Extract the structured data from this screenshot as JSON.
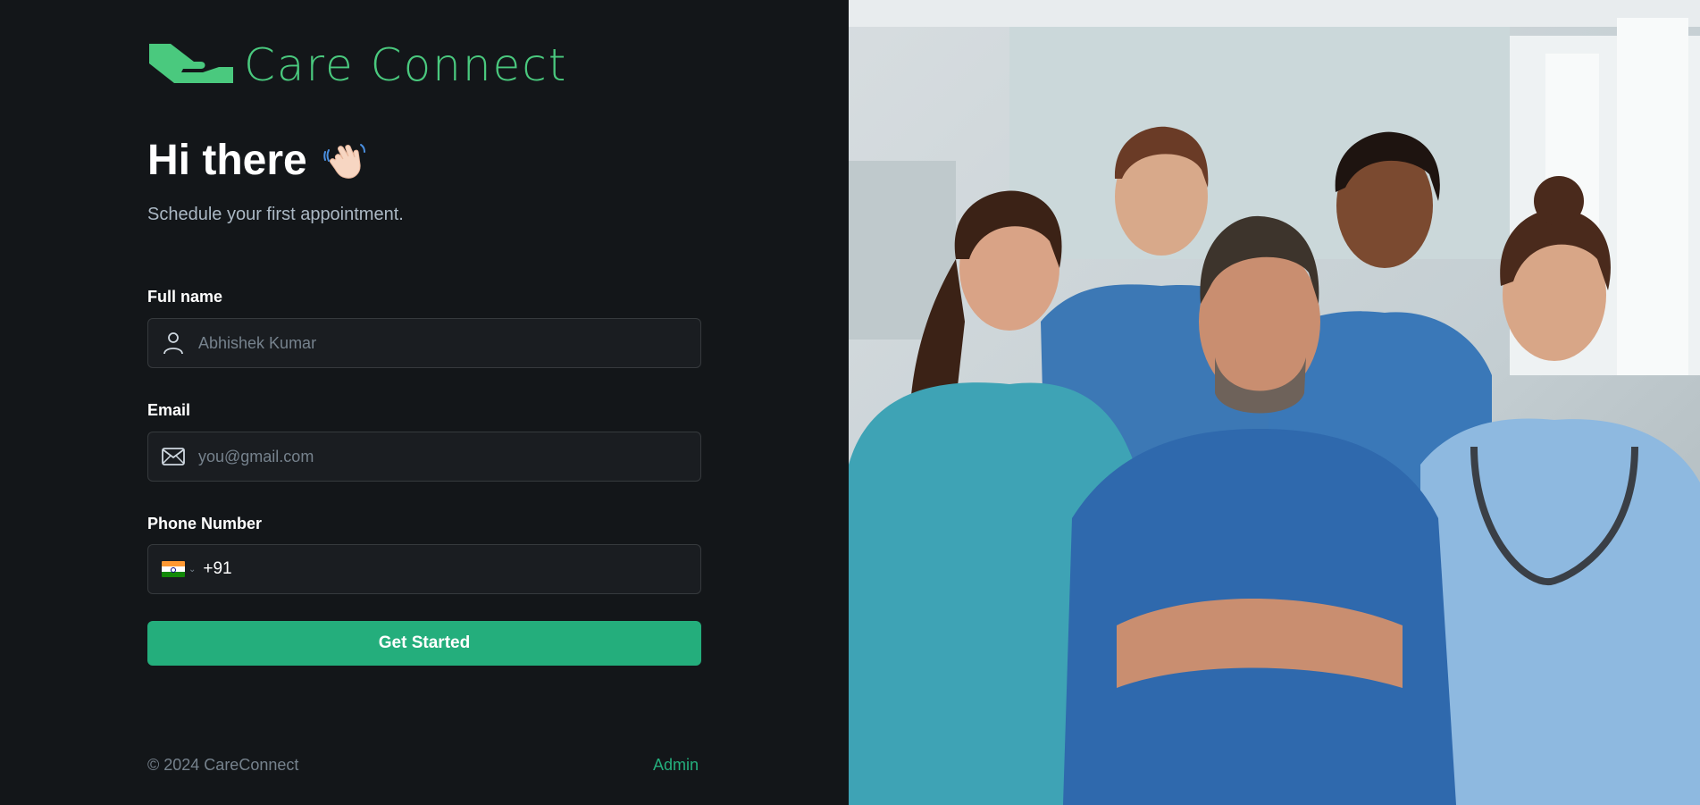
{
  "brand": {
    "name": "Care Connect",
    "color": "#4ac97e"
  },
  "hero": {
    "title": "Hi there",
    "subtitle": "Schedule your first appointment."
  },
  "form": {
    "name": {
      "label": "Full name",
      "placeholder": "Abhishek Kumar",
      "icon": "user-icon"
    },
    "email": {
      "label": "Email",
      "placeholder": "you@gmail.com",
      "icon": "mail-icon"
    },
    "phone": {
      "label": "Phone Number",
      "country": "India",
      "code": "+91",
      "icon": "india-flag-icon"
    },
    "submit_label": "Get Started"
  },
  "footer": {
    "copyright": "© 2024 CareConnect",
    "admin_label": "Admin"
  },
  "colors": {
    "background": "#131619",
    "accent": "#24ae7c",
    "input_bg": "#1a1d21",
    "input_border": "#363a3d"
  },
  "image": {
    "subject": "medical-staff-photo"
  }
}
